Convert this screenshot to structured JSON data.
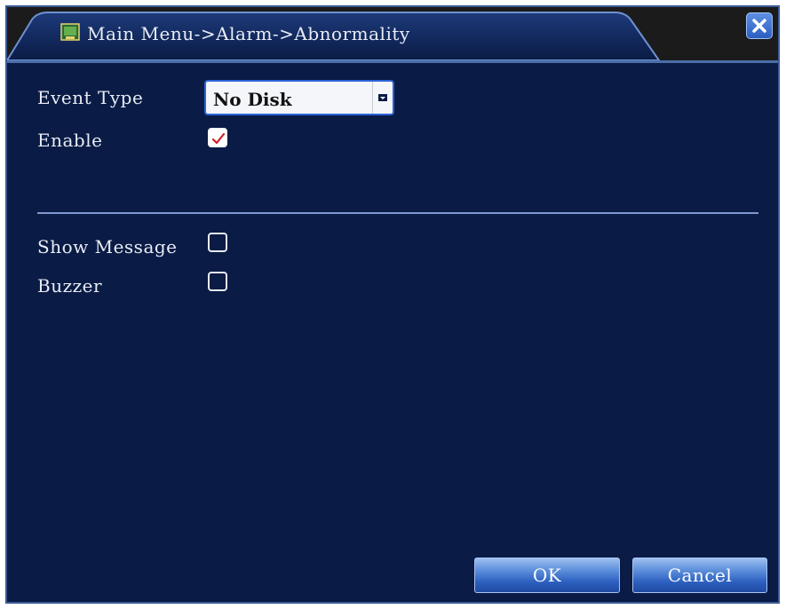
{
  "window": {
    "title": "Main Menu->Alarm->Abnormality"
  },
  "form": {
    "event_type_label": "Event Type",
    "event_type_value": "No Disk",
    "enable_label": "Enable",
    "enable_checked": true,
    "show_message_label": "Show Message",
    "show_message_checked": false,
    "buzzer_label": "Buzzer",
    "buzzer_checked": false
  },
  "buttons": {
    "ok_label": "OK",
    "cancel_label": "Cancel"
  },
  "icons": {
    "title_icon": "menu-screen-icon",
    "close_icon": "close-icon",
    "dropdown_icon": "dropdown-arrow-icon",
    "check_icon": "check-icon"
  },
  "colors": {
    "background": "#0a1b45",
    "accent": "#2c62d6",
    "check": "#d0202a"
  }
}
